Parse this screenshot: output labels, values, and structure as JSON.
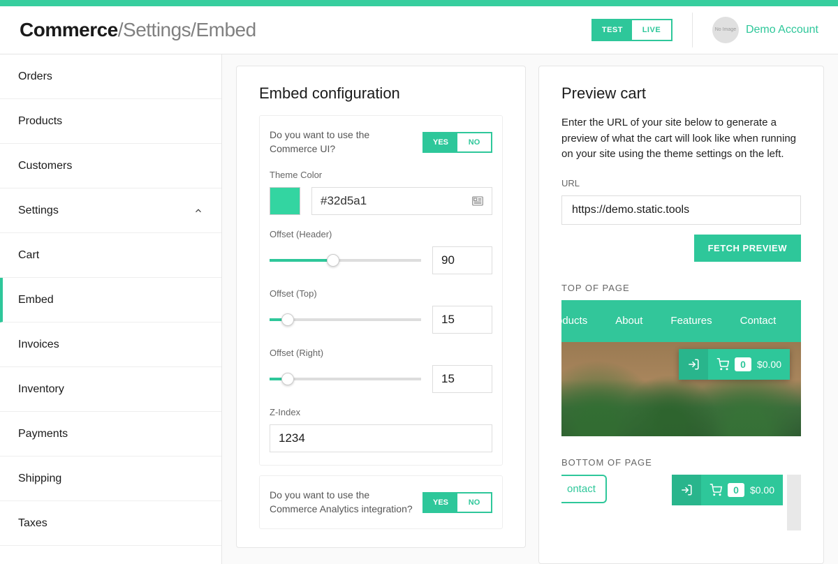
{
  "header": {
    "breadcrumb_strong": "Commerce",
    "breadcrumb_rest": "/Settings/Embed",
    "mode": {
      "test": "TEST",
      "live": "LIVE",
      "active": "test"
    },
    "account": {
      "avatar_text": "No Image",
      "name": "Demo Account"
    }
  },
  "sidebar": {
    "items": [
      {
        "label": "Orders"
      },
      {
        "label": "Products"
      },
      {
        "label": "Customers"
      },
      {
        "label": "Settings",
        "expanded": true,
        "children": [
          {
            "label": "Cart"
          },
          {
            "label": "Embed",
            "active": true
          },
          {
            "label": "Invoices"
          },
          {
            "label": "Inventory"
          },
          {
            "label": "Payments"
          },
          {
            "label": "Shipping"
          },
          {
            "label": "Taxes"
          }
        ]
      }
    ]
  },
  "config": {
    "title": "Embed configuration",
    "use_ui": {
      "question": "Do you want to use the Commerce UI?",
      "yes": "YES",
      "no": "NO",
      "value": "yes"
    },
    "theme_color": {
      "label": "Theme Color",
      "value": "#32d5a1"
    },
    "offset_header": {
      "label": "Offset (Header)",
      "value": "90",
      "percent": 42
    },
    "offset_top": {
      "label": "Offset (Top)",
      "value": "15",
      "percent": 12
    },
    "offset_right": {
      "label": "Offset (Right)",
      "value": "15",
      "percent": 12
    },
    "z_index": {
      "label": "Z-Index",
      "value": "1234"
    },
    "analytics": {
      "question": "Do you want to use the Commerce Analytics integration?",
      "yes": "YES",
      "no": "NO",
      "value": "yes"
    }
  },
  "preview": {
    "title": "Preview cart",
    "desc": "Enter the URL of your site below to generate a preview of what the cart will look like when running on your site using the theme settings on the left.",
    "url_label": "URL",
    "url_value": "https://demo.static.tools",
    "fetch_label": "FETCH PREVIEW",
    "top_label": "TOP OF PAGE",
    "bottom_label": "BOTTOM OF PAGE",
    "nav": [
      "roducts",
      "About",
      "Features",
      "Contact"
    ],
    "cart": {
      "count": "0",
      "amount": "$0.00"
    },
    "bottom_pill": "ontact"
  }
}
